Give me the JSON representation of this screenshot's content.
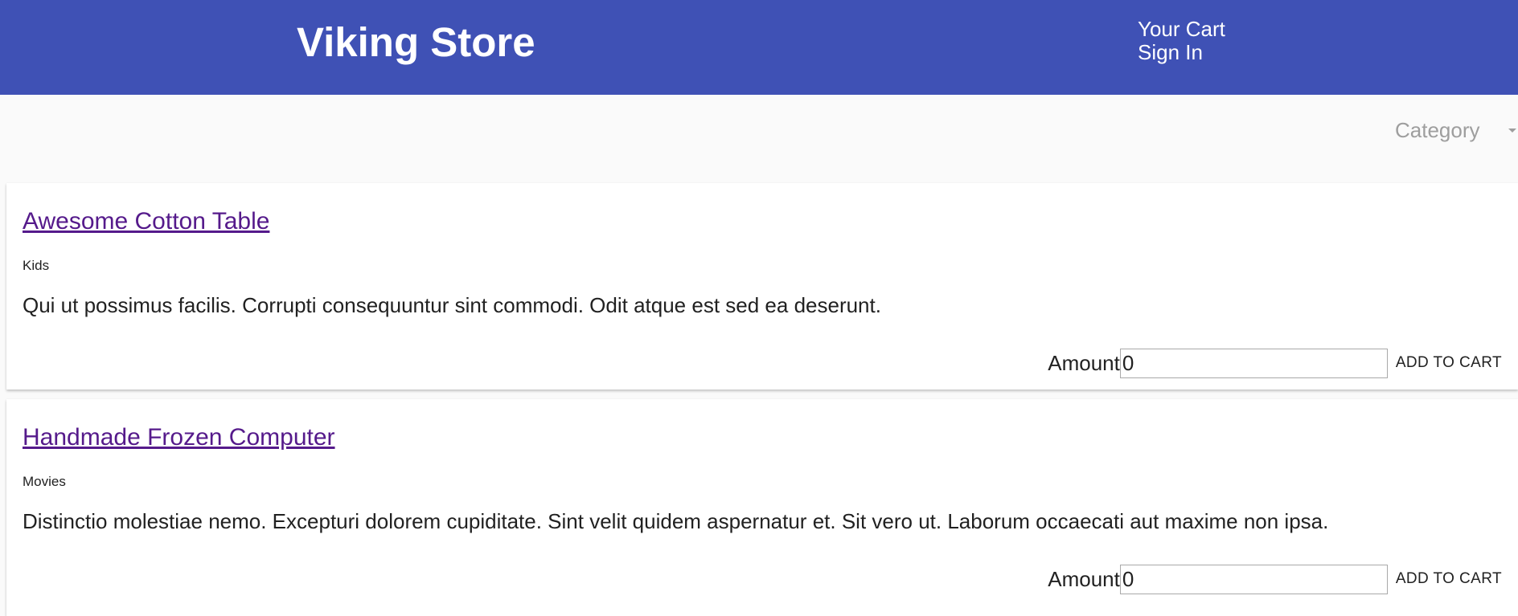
{
  "header": {
    "title": "Viking Store",
    "nav": [
      "Your Cart",
      "Sign In"
    ],
    "background": "#3f51b5"
  },
  "filters": {
    "category_placeholder": "Category"
  },
  "products": [
    {
      "name": "Awesome Cotton Table",
      "category": "Kids",
      "description": "Qui ut possimus facilis. Corrupti consequuntur sint commodi. Odit atque est sed ea deserunt.",
      "amount_label": "Amount",
      "amount_value": "0",
      "add_label": "ADD TO CART"
    },
    {
      "name": "Handmade Frozen Computer",
      "category": "Movies",
      "description": "Distinctio molestiae nemo. Excepturi dolorem cupiditate. Sint velit quidem aspernatur et. Sit vero ut. Laborum occaecati aut maxime non ipsa.",
      "amount_label": "Amount",
      "amount_value": "0",
      "add_label": "ADD TO CART"
    }
  ]
}
